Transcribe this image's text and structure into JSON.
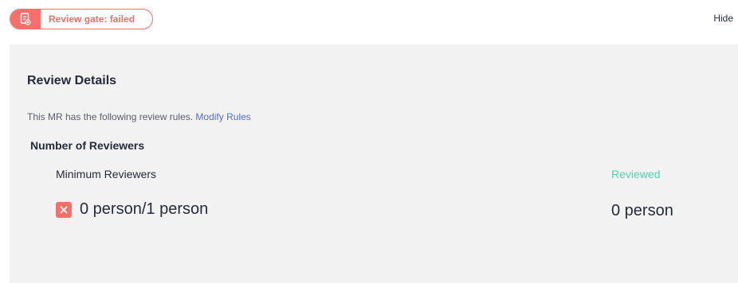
{
  "header": {
    "gate_status": "Review gate: failed",
    "gate_icon": "document-clipboard-icon",
    "hide_label": "Hide"
  },
  "panel": {
    "title": "Review Details",
    "rules_text": "This MR has the following review rules.",
    "modify_rules_label": "Modify Rules",
    "section_title": "Number of Reviewers",
    "minimum_reviewers_label": "Minimum Reviewers",
    "reviewed_label": "Reviewed",
    "minimum_value": "0 person/1 person",
    "reviewed_value": "0 person",
    "status_icon": "close-x-icon"
  },
  "colors": {
    "danger": "#f66f6a",
    "success": "#50d4ab",
    "link": "#526ecc",
    "panel_bg": "#f2f2f2"
  }
}
